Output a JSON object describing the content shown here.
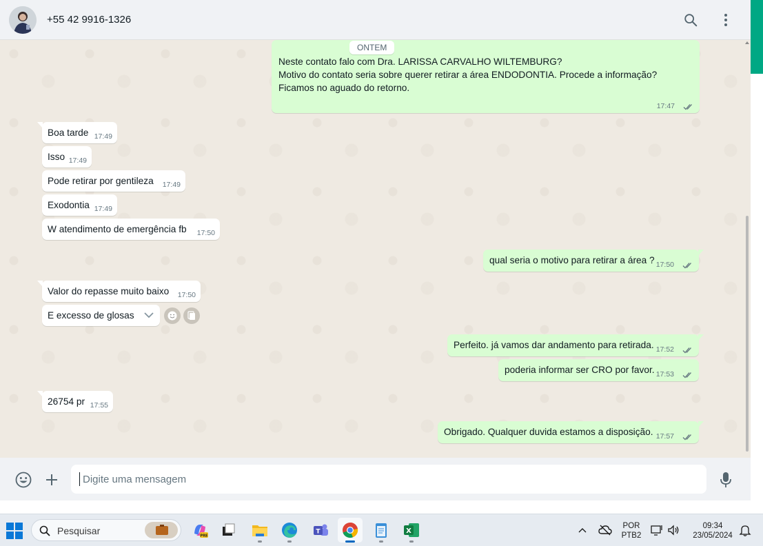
{
  "header": {
    "contact": "+55 42 9916-1326",
    "icons": [
      "search-icon",
      "menu-kebab-icon"
    ]
  },
  "chat": {
    "date_chip": "ONTEM",
    "messages": [
      {
        "dir": "out",
        "lines": [
          "Neste contato falo com Dra. LARISSA CARVALHO WILTEMBURG?",
          "",
          "Motivo do contato seria sobre querer retirar a área ENDODONTIA. Procede a informação?",
          "Ficamos no aguado do retorno."
        ],
        "time": "17:47"
      },
      {
        "dir": "in",
        "text": "Boa tarde",
        "time": "17:49"
      },
      {
        "dir": "in",
        "text": "Isso",
        "time": "17:49"
      },
      {
        "dir": "in",
        "text": "Pode retirar por gentileza",
        "time": "17:49"
      },
      {
        "dir": "in",
        "text": "Exodontia",
        "time": "17:49"
      },
      {
        "dir": "in",
        "text": "W atendimento de emergência fb",
        "time": "17:50"
      },
      {
        "dir": "out",
        "text": "qual seria o motivo para retirar a área ?",
        "time": "17:50"
      },
      {
        "dir": "in",
        "text": "Valor do repasse muito baixo",
        "time": "17:50"
      },
      {
        "dir": "in",
        "text": "E excesso de glosas",
        "time": ""
      },
      {
        "dir": "out",
        "text": "Perfeito. já vamos dar andamento para retirada.",
        "time": "17:52"
      },
      {
        "dir": "out",
        "text": "poderia informar ser CRO por favor.",
        "time": "17:53"
      },
      {
        "dir": "in",
        "text": "26754 pr",
        "time": "17:55"
      },
      {
        "dir": "out",
        "text": "Obrigado. Qualquer duvida estamos a disposição.",
        "time": "17:57"
      }
    ]
  },
  "composer": {
    "placeholder": "Digite uma mensagem",
    "icons": [
      "emoji-icon",
      "plus-icon",
      "microphone-icon"
    ]
  },
  "taskbar": {
    "search_label": "Pesquisar",
    "apps": [
      "copilot",
      "task-view",
      "file-explorer",
      "edge",
      "teams",
      "chrome",
      "notepad",
      "excel"
    ],
    "active_app": "chrome",
    "lang_line1": "POR",
    "lang_line2": "PTB2",
    "time": "09:34",
    "date": "23/05/2024"
  },
  "colors": {
    "accent": "#00a884",
    "bubble_out": "#d9fdd3",
    "bubble_in": "#ffffff",
    "chat_bg": "#efeae2",
    "tick_read": "#667781"
  }
}
